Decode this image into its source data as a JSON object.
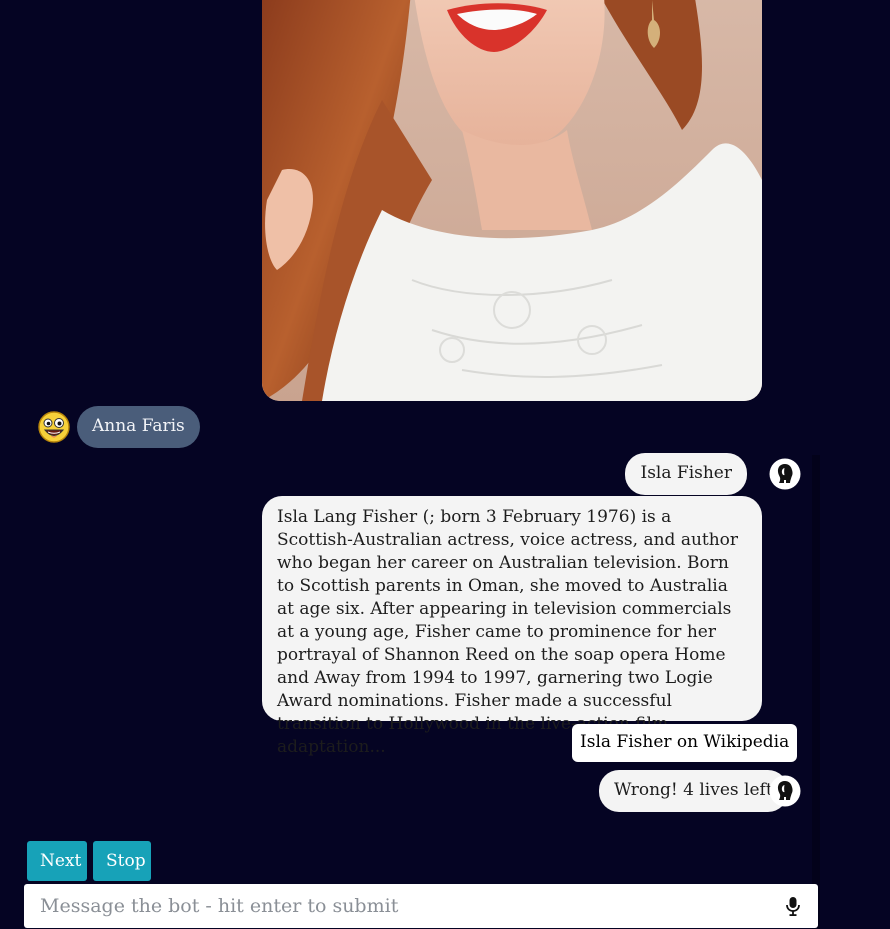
{
  "chat": {
    "photo": {
      "alt": "Portrait photo of a red-haired woman in a white lace top"
    },
    "user_messages": [
      {
        "text": "Anna Faris",
        "avatar_icon": "laughing-emoji-icon"
      }
    ],
    "bot_messages": [
      {
        "text": "Isla Fisher",
        "avatar_icon": "head-silhouette-icon"
      },
      {
        "text": "Isla Lang Fisher (; born 3 February 1976) is a Scottish-Australian actress, voice actress, and author who began her career on Australian television. Born to Scottish parents in Oman, she moved to Australia at age six. After appearing in television commercials at a young age, Fisher came to prominence for her portrayal of Shannon Reed on the soap opera Home and Away from 1994 to 1997, garnering two Logie Award nominations. Fisher made a successful transition to Hollywood in the live-action film adaptation..."
      },
      {
        "text": "Isla Fisher on Wikipedia"
      },
      {
        "text": "Wrong! 4 lives left",
        "avatar_icon": "head-silhouette-icon"
      }
    ]
  },
  "controls": {
    "next_label": "Next",
    "stop_label": "Stop"
  },
  "composer": {
    "placeholder": "Message the bot - hit enter to submit",
    "value": "",
    "mic_icon": "microphone-icon"
  },
  "colors": {
    "background": "#050423",
    "button": "#17a2b8",
    "user_bubble": "#4a5d7a",
    "bot_bubble": "#f4f4f4"
  }
}
